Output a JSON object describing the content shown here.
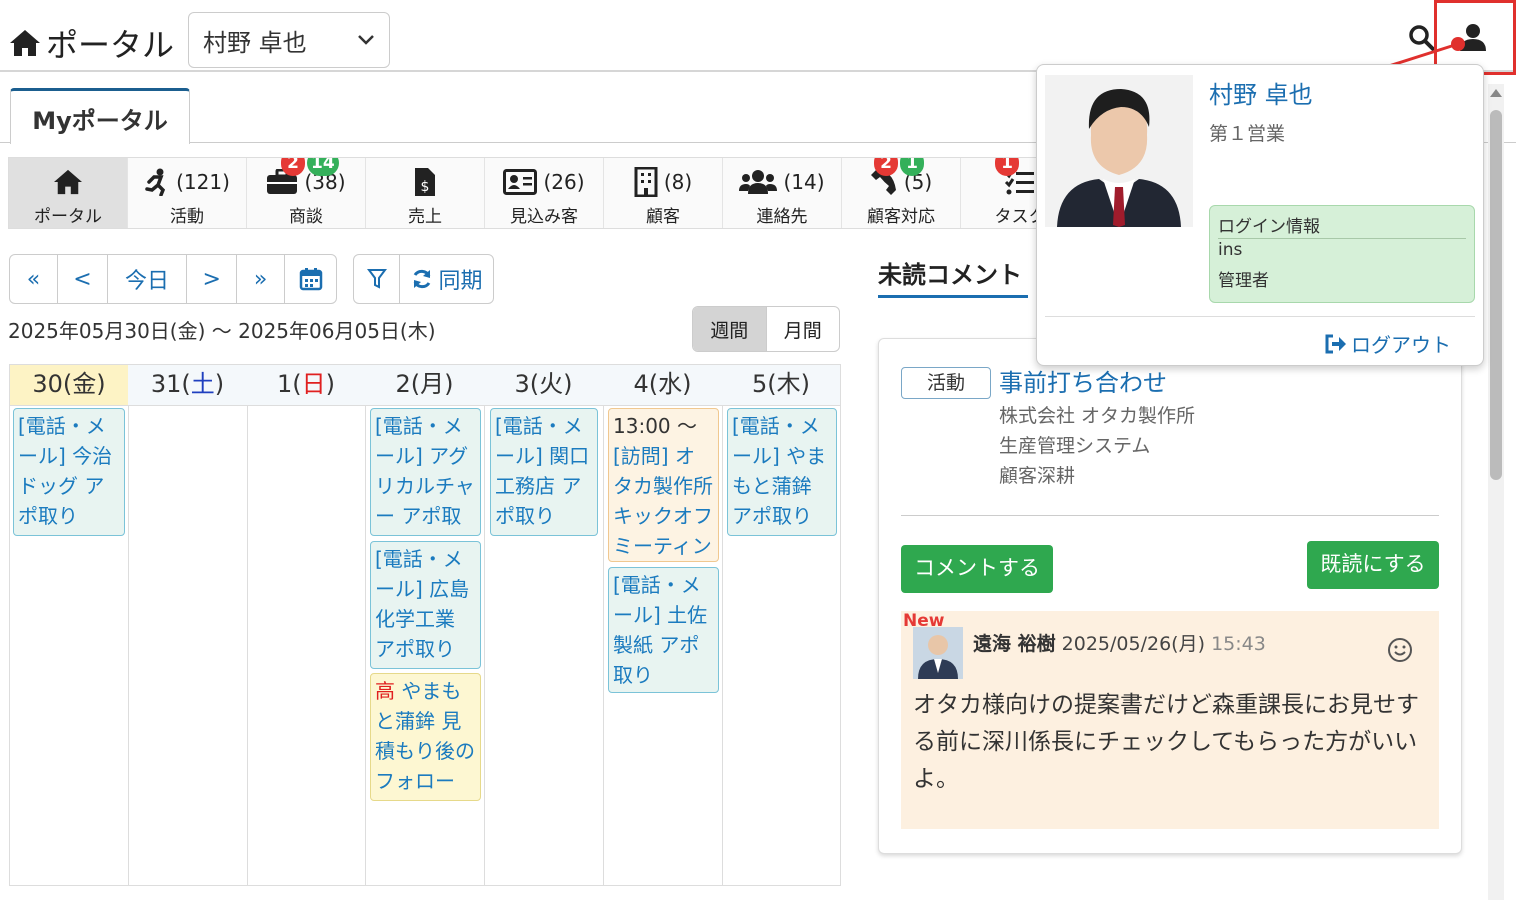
{
  "header": {
    "logo_text": "ポータル",
    "user_select": "村野 卓也"
  },
  "tab": {
    "label": "Myポータル"
  },
  "nav": [
    {
      "label": "ポータル",
      "count": "",
      "icon": "home-icon"
    },
    {
      "label": "活動",
      "count": "(121)",
      "icon": "running-icon"
    },
    {
      "label": "商談",
      "count": "(38)",
      "icon": "briefcase-icon",
      "badge_red": "2",
      "badge_green": "14"
    },
    {
      "label": "売上",
      "count": "",
      "icon": "invoice-icon"
    },
    {
      "label": "見込み客",
      "count": "(26)",
      "icon": "id-card-icon"
    },
    {
      "label": "顧客",
      "count": "(8)",
      "icon": "building-icon"
    },
    {
      "label": "連絡先",
      "count": "(14)",
      "icon": "users-icon"
    },
    {
      "label": "顧客対応",
      "count": "(5)",
      "icon": "phone-icon",
      "badge_red": "2",
      "badge_green": "1"
    },
    {
      "label": "タスク",
      "count": "",
      "icon": "tasks-icon",
      "badge_red": "1"
    }
  ],
  "toolbar": {
    "first": "«",
    "prev": "<",
    "today": "今日",
    "next": ">",
    "last": "»",
    "sync": "同期"
  },
  "date_range": "2025年05月30日(金) ～ 2025年06月05日(木)",
  "view": {
    "week": "週間",
    "month": "月間"
  },
  "days": [
    {
      "num": "30(",
      "wd": "金",
      "close": ")"
    },
    {
      "num": "31(",
      "wd": "土",
      "close": ")"
    },
    {
      "num": "1(",
      "wd": "日",
      "close": ")"
    },
    {
      "num": "2(",
      "wd": "月",
      "close": ")"
    },
    {
      "num": "3(",
      "wd": "火",
      "close": ")"
    },
    {
      "num": "4(",
      "wd": "水",
      "close": ")"
    },
    {
      "num": "5(",
      "wd": "木",
      "close": ")"
    }
  ],
  "events": {
    "e1": "[電話・メール] 今治ドッグ アポ取り",
    "e2": "[電話・メール] アグリカルチャー アポ取り",
    "e3": "[電話・メール] 広島化学工業 アポ取り",
    "e4_pri": "高",
    "e4": " やまもと蒲鉾 見積もり後のフォロー",
    "e5": "[電話・メール] 関口工務店 アポ取り",
    "e6_time": "13:00 ～",
    "e6": "[訪問] オタカ製作所 キックオフミーティング",
    "e7": "[電話・メール] 土佐製紙 アポ取り",
    "e8": "[電話・メール] やまもと蒲鉾 アポ取り"
  },
  "comments": {
    "tab_label": "未読コメント",
    "tag": "活動",
    "title": "事前打ち合わせ",
    "line1": "株式会社 オタカ製作所",
    "line2": "生産管理システム",
    "line3": "顧客深耕",
    "comment_btn": "コメントする",
    "read_btn": "既読にする",
    "new_label": "New",
    "author": "遠海 裕樹",
    "datetime": "2025/05/26(月)",
    "time": "15:43",
    "body": "オタカ様向けの提案書だけど森重課長にお見せする前に深川係長にチェックしてもらった方がいいよ。"
  },
  "popup": {
    "name": "村野 卓也",
    "dept": "第１営業",
    "login_title": "ログイン情報",
    "login_id": "ins",
    "role": "管理者",
    "logout": "ログアウト"
  }
}
